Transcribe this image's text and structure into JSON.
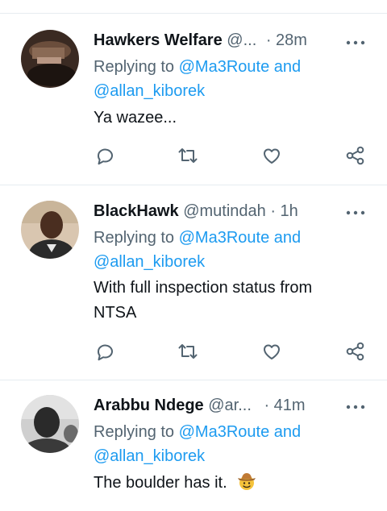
{
  "tweets": [
    {
      "name": "Hawkers Welfare",
      "handle": "@...",
      "time": "· 28m",
      "replying_prefix": "Replying to ",
      "mention1": "@Ma3Route",
      "and": " and",
      "mention2": "@allan_kiborek",
      "text": "Ya wazee..."
    },
    {
      "name": "BlackHawk",
      "handle": "@mutindah",
      "time": "· 1h",
      "replying_prefix": "Replying to ",
      "mention1": "@Ma3Route",
      "and": " and",
      "mention2": "@allan_kiborek",
      "text_line1": "With full inspection status from",
      "text_line2": "NTSA"
    },
    {
      "name": "Arabbu Ndege",
      "handle": "@ar...",
      "time": "· 41m",
      "replying_prefix": "Replying to ",
      "mention1": "@Ma3Route",
      "and": " and",
      "mention2": "@allan_kiborek",
      "text": "The boulder has it."
    }
  ],
  "icons": [
    "more-icon",
    "reply-icon",
    "retweet-icon",
    "like-icon",
    "share-icon",
    "cowboy-emoji"
  ],
  "colors": {
    "link": "#1d9bf0",
    "secondary": "#536471",
    "text": "#0f1419",
    "separator": "#e6ecf0"
  }
}
